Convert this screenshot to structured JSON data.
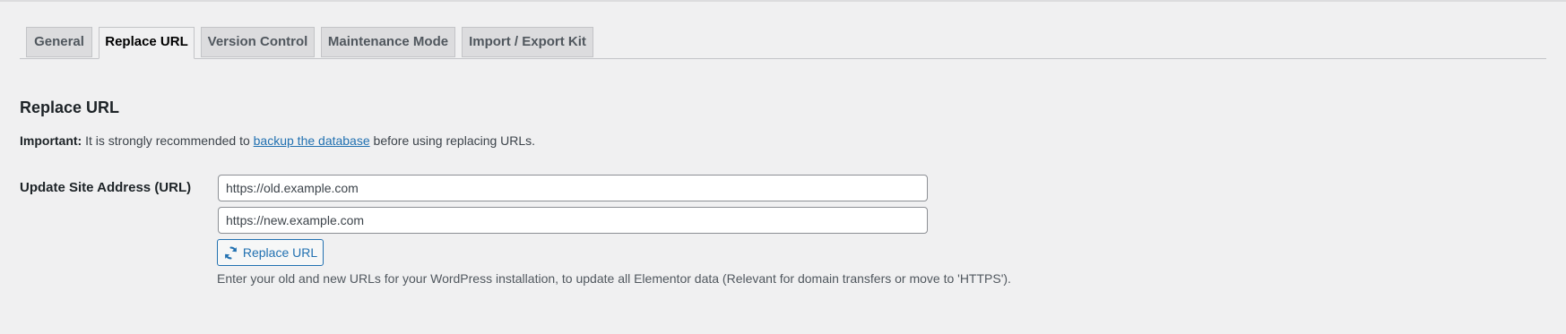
{
  "tabs": [
    {
      "label": "General"
    },
    {
      "label": "Replace URL",
      "active": true
    },
    {
      "label": "Version Control"
    },
    {
      "label": "Maintenance Mode"
    },
    {
      "label": "Import / Export Kit"
    }
  ],
  "section": {
    "title": "Replace URL",
    "notice_strong": "Important:",
    "notice_before": " It is strongly recommended to ",
    "notice_link": "backup the database",
    "notice_after": " before using replacing URLs."
  },
  "form": {
    "label": "Update Site Address (URL)",
    "old_url_placeholder": "https://old.example.com",
    "new_url_placeholder": "https://new.example.com",
    "button_label": "Replace URL",
    "button_icon": "refresh-icon",
    "description": "Enter your old and new URLs for your WordPress installation, to update all Elementor data (Relevant for domain transfers or move to 'HTTPS')."
  },
  "colors": {
    "background": "#f0f0f1",
    "accent": "#2271b1",
    "tab_inactive": "#dcdcde"
  }
}
